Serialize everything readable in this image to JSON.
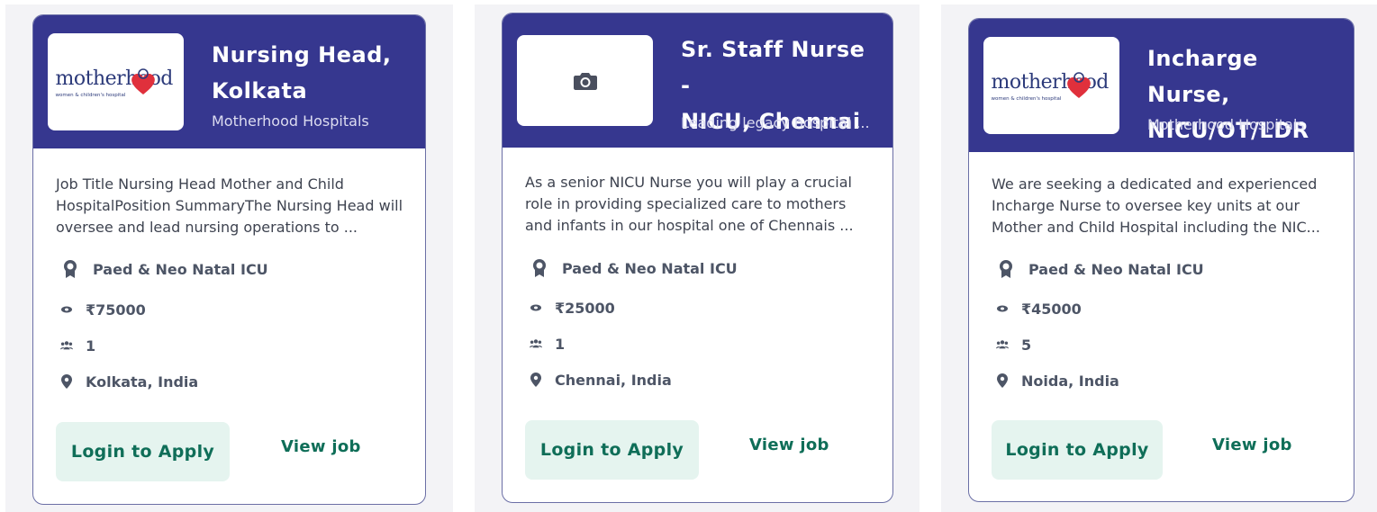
{
  "colors": {
    "header": "#36378f",
    "accent_green": "#0f6e58",
    "apply_bg": "#e5f4ef",
    "card_border": "#6b6fa6"
  },
  "cards": [
    {
      "logo": "motherhood-logo",
      "logo_text": "motherhood",
      "logo_sub": "women & children's hospital",
      "title_line1": "Nursing Head,",
      "title_line2": "Kolkata",
      "company": "Motherhood Hospitals",
      "description": "Job Title Nursing Head  Mother and Child HospitalPosition SummaryThe Nursing Head will oversee and lead nursing operations to ...",
      "department": "Paed & Neo Natal ICU",
      "salary": "₹75000",
      "openings": "1",
      "location": "Kolkata, India",
      "apply_label": "Login to Apply",
      "view_label": "View job"
    },
    {
      "logo": "camera-icon",
      "title_line1": "Sr. Staff Nurse -",
      "title_line2": "NICU, Chennai",
      "company": "Leading legacy hospital ...",
      "description": "As a senior NICU Nurse you will play a crucial role in providing specialized care to mothers and infants in our hospital one of Chennais ...",
      "department": "Paed & Neo Natal ICU",
      "salary": "₹25000",
      "openings": "1",
      "location": "Chennai, India",
      "apply_label": "Login to Apply",
      "view_label": "View job"
    },
    {
      "logo": "motherhood-logo",
      "logo_text": "motherhood",
      "logo_sub": "women & children's hospital",
      "title_line1": "Incharge Nurse,",
      "title_line2": "NICU/OT/LDR ...",
      "company": "Motherhood Hospitals",
      "description": "We are seeking a dedicated and experienced Incharge Nurse to oversee key units at our Mother and Child Hospital including the NIC...",
      "department": "Paed & Neo Natal ICU",
      "salary": "₹45000",
      "openings": "5",
      "location": "Noida, India",
      "apply_label": "Login to Apply",
      "view_label": "View job"
    }
  ]
}
